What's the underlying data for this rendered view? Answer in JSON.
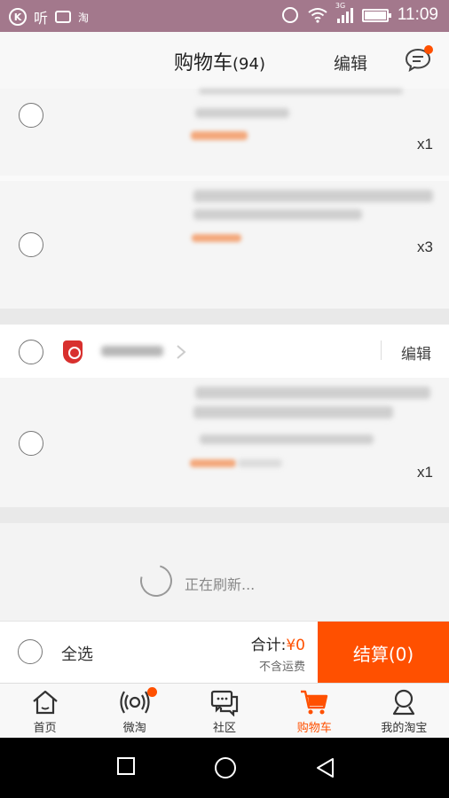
{
  "status_bar": {
    "time": "11:09",
    "network": "3G",
    "left_text": "听",
    "taobao_text": "淘"
  },
  "header": {
    "title": "购物车",
    "count": "(94)",
    "edit_label": "编辑"
  },
  "items": [
    {
      "quantity": "x1"
    },
    {
      "quantity": "x3"
    },
    {
      "quantity": "x1"
    }
  ],
  "shop": {
    "edit_label": "编辑"
  },
  "refresh": {
    "text": "正在刷新..."
  },
  "bottom": {
    "select_all": "全选",
    "total_label": "合计:",
    "total_amount": "¥0",
    "shipping_note": "不含运费",
    "checkout_label": "结算(0)"
  },
  "tabs": [
    {
      "label": "首页",
      "icon": "home-icon",
      "active": false
    },
    {
      "label": "微淘",
      "icon": "broadcast-icon",
      "active": false
    },
    {
      "label": "社区",
      "icon": "chat-icon",
      "active": false
    },
    {
      "label": "购物车",
      "icon": "cart-icon",
      "active": true
    },
    {
      "label": "我的淘宝",
      "icon": "user-icon",
      "active": false
    }
  ],
  "colors": {
    "accent": "#ff5000",
    "status_bar": "#a3788c"
  }
}
